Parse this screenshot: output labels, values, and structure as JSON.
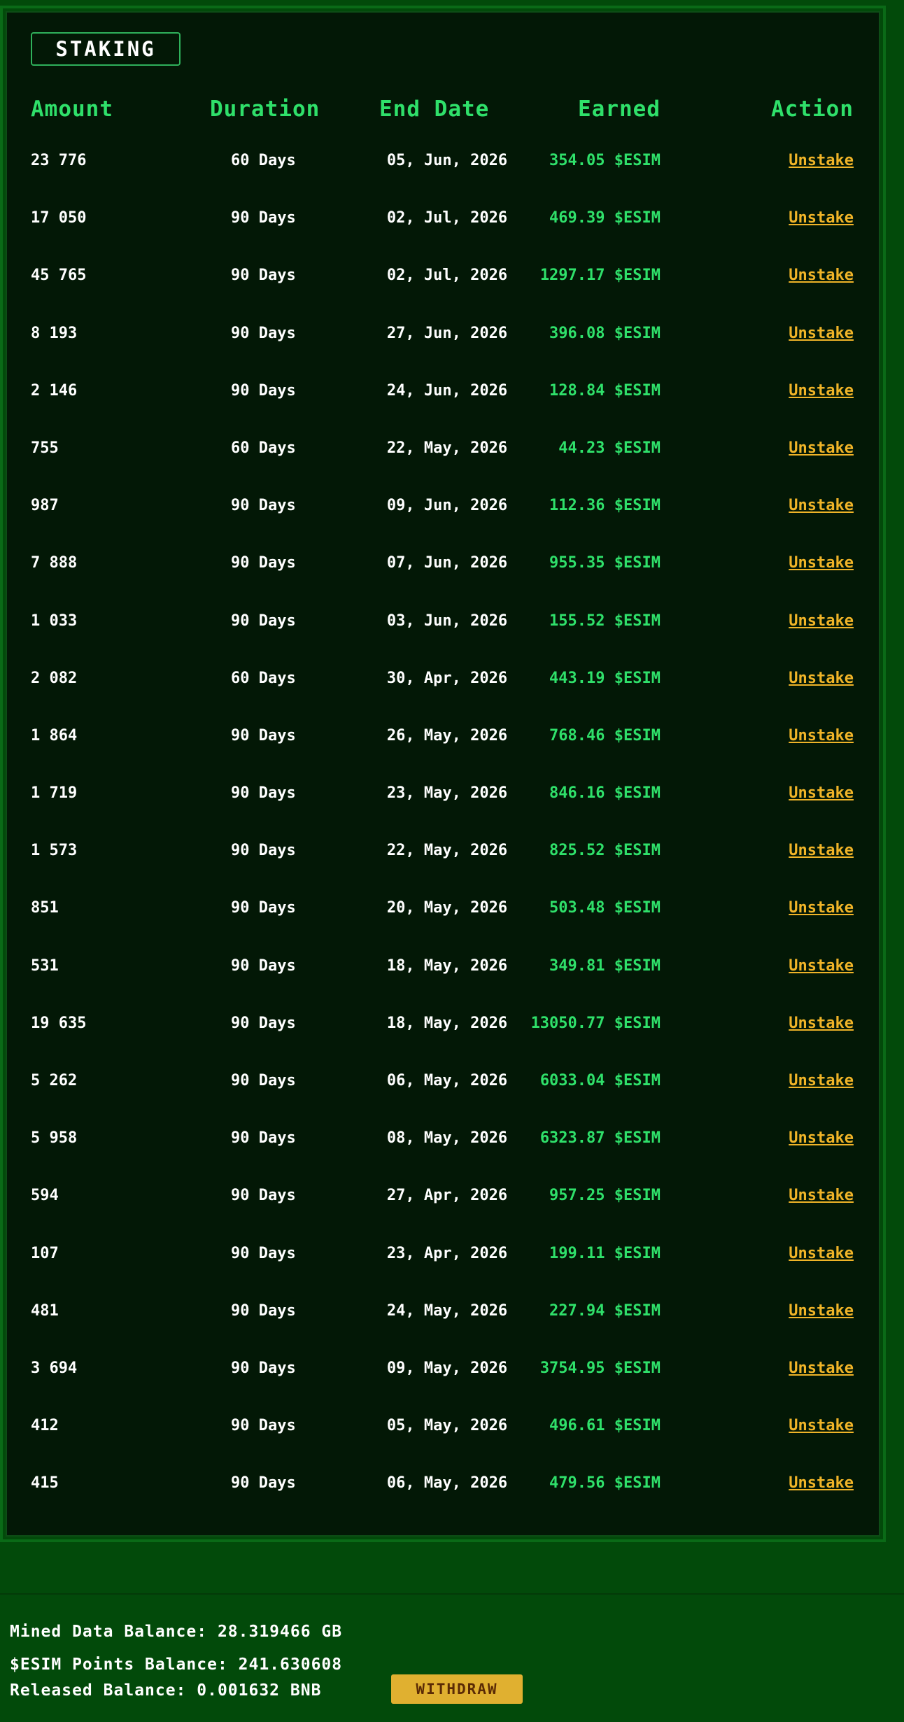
{
  "staking": {
    "tab_label": "STAKING",
    "headers": {
      "amount": "Amount",
      "duration": "Duration",
      "end_date": "End Date",
      "earned": "Earned",
      "action": "Action"
    },
    "rows": [
      {
        "amount": "23 776",
        "duration": "60 Days",
        "end_date": "05, Jun, 2026",
        "earned": "354.05 $ESIM",
        "action": "Unstake"
      },
      {
        "amount": "17 050",
        "duration": "90 Days",
        "end_date": "02, Jul, 2026",
        "earned": "469.39 $ESIM",
        "action": "Unstake"
      },
      {
        "amount": "45 765",
        "duration": "90 Days",
        "end_date": "02, Jul, 2026",
        "earned": "1297.17 $ESIM",
        "action": "Unstake"
      },
      {
        "amount": "8 193",
        "duration": "90 Days",
        "end_date": "27, Jun, 2026",
        "earned": "396.08 $ESIM",
        "action": "Unstake"
      },
      {
        "amount": "2 146",
        "duration": "90 Days",
        "end_date": "24, Jun, 2026",
        "earned": "128.84 $ESIM",
        "action": "Unstake"
      },
      {
        "amount": "755",
        "duration": "60 Days",
        "end_date": "22, May, 2026",
        "earned": "44.23 $ESIM",
        "action": "Unstake"
      },
      {
        "amount": "987",
        "duration": "90 Days",
        "end_date": "09, Jun, 2026",
        "earned": "112.36 $ESIM",
        "action": "Unstake"
      },
      {
        "amount": "7 888",
        "duration": "90 Days",
        "end_date": "07, Jun, 2026",
        "earned": "955.35 $ESIM",
        "action": "Unstake"
      },
      {
        "amount": "1 033",
        "duration": "90 Days",
        "end_date": "03, Jun, 2026",
        "earned": "155.52 $ESIM",
        "action": "Unstake"
      },
      {
        "amount": "2 082",
        "duration": "60 Days",
        "end_date": "30, Apr, 2026",
        "earned": "443.19 $ESIM",
        "action": "Unstake"
      },
      {
        "amount": "1 864",
        "duration": "90 Days",
        "end_date": "26, May, 2026",
        "earned": "768.46 $ESIM",
        "action": "Unstake"
      },
      {
        "amount": "1 719",
        "duration": "90 Days",
        "end_date": "23, May, 2026",
        "earned": "846.16 $ESIM",
        "action": "Unstake"
      },
      {
        "amount": "1 573",
        "duration": "90 Days",
        "end_date": "22, May, 2026",
        "earned": "825.52 $ESIM",
        "action": "Unstake"
      },
      {
        "amount": "851",
        "duration": "90 Days",
        "end_date": "20, May, 2026",
        "earned": "503.48 $ESIM",
        "action": "Unstake"
      },
      {
        "amount": "531",
        "duration": "90 Days",
        "end_date": "18, May, 2026",
        "earned": "349.81 $ESIM",
        "action": "Unstake"
      },
      {
        "amount": "19 635",
        "duration": "90 Days",
        "end_date": "18, May, 2026",
        "earned": "13050.77 $ESIM",
        "action": "Unstake"
      },
      {
        "amount": "5 262",
        "duration": "90 Days",
        "end_date": "06, May, 2026",
        "earned": "6033.04 $ESIM",
        "action": "Unstake"
      },
      {
        "amount": "5 958",
        "duration": "90 Days",
        "end_date": "08, May, 2026",
        "earned": "6323.87 $ESIM",
        "action": "Unstake"
      },
      {
        "amount": "594",
        "duration": "90 Days",
        "end_date": "27, Apr, 2026",
        "earned": "957.25 $ESIM",
        "action": "Unstake"
      },
      {
        "amount": "107",
        "duration": "90 Days",
        "end_date": "23, Apr, 2026",
        "earned": "199.11 $ESIM",
        "action": "Unstake"
      },
      {
        "amount": "481",
        "duration": "90 Days",
        "end_date": "24, May, 2026",
        "earned": "227.94 $ESIM",
        "action": "Unstake"
      },
      {
        "amount": "3 694",
        "duration": "90 Days",
        "end_date": "09, May, 2026",
        "earned": "3754.95 $ESIM",
        "action": "Unstake"
      },
      {
        "amount": "412",
        "duration": "90 Days",
        "end_date": "05, May, 2026",
        "earned": "496.61 $ESIM",
        "action": "Unstake"
      },
      {
        "amount": "415",
        "duration": "90 Days",
        "end_date": "06, May, 2026",
        "earned": "479.56 $ESIM",
        "action": "Unstake"
      }
    ]
  },
  "footer": {
    "mined_data_balance": "Mined Data Balance: 28.319466 GB",
    "esim_points_balance": "$ESIM Points Balance: 241.630608",
    "released_balance": "Released Balance: 0.001632 BNB",
    "withdraw_label": "WITHDRAW"
  },
  "colors": {
    "background": "#024a0a",
    "panel": "#031806",
    "accent_green": "#2fe06a",
    "action_gold": "#f0b428",
    "button_gold": "#e0b030"
  }
}
